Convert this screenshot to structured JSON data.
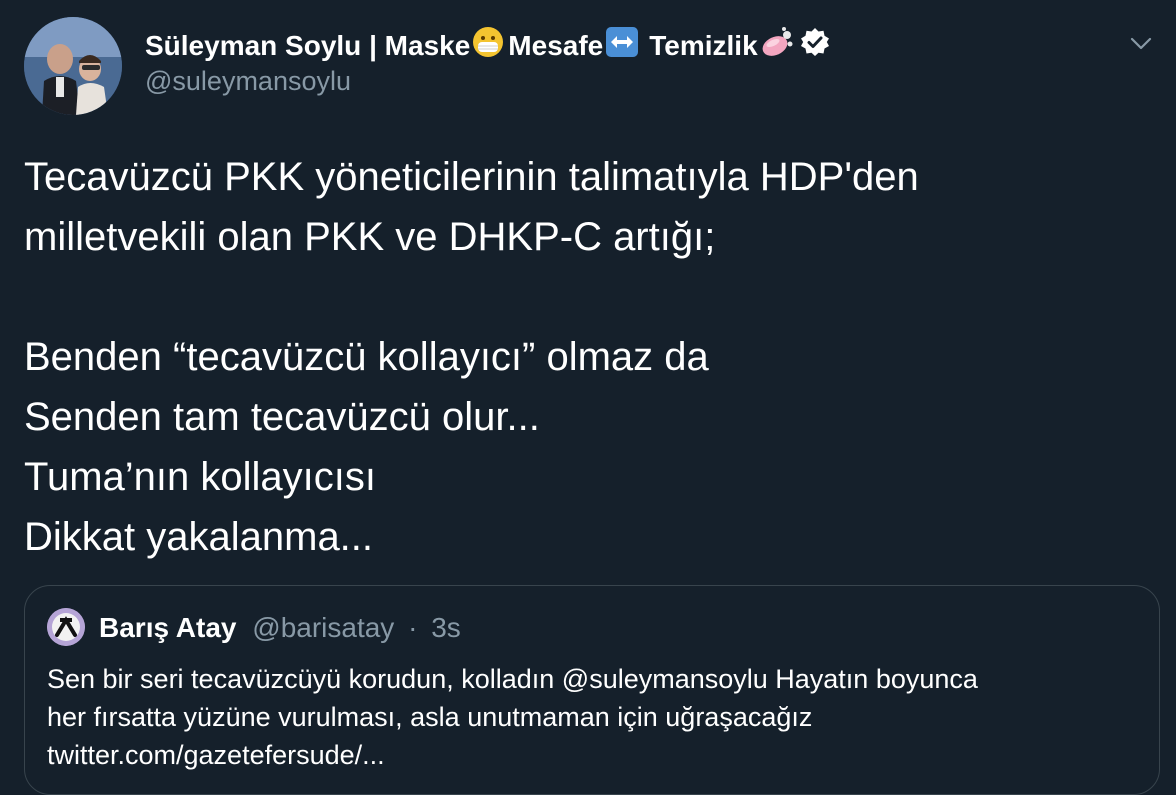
{
  "author": {
    "name": "Süleyman Soylu | Maske",
    "name_part2": "Mesafe",
    "name_part3": "Temizlik",
    "handle": "@suleymansoylu",
    "name_emojis": [
      "mask-emoji",
      "left-right-arrow-emoji",
      "soap-emoji"
    ],
    "verified": true
  },
  "tweet": {
    "lines": [
      "Tecavüzcü PKK yöneticilerinin talimatıyla HDP'den",
      "milletvekili olan PKK ve DHKP-C artığı;",
      "",
      "Benden “tecavüzcü kollayıcı” olmaz da",
      "Senden tam tecavüzcü olur...",
      "Tuma’nın kollayıcısı",
      "Dikkat yakalanma..."
    ]
  },
  "quoted": {
    "name": "Barış Atay",
    "handle": "@barisatay",
    "separator": "·",
    "time": "3s",
    "lines": [
      "Sen bir seri tecavüzcüyü korudun, kolladın @suleymansoylu Hayatın boyunca",
      "her fırsatta yüzüne vurulması, asla unutmaman için uğraşacağız",
      "twitter.com/gazetefersude/..."
    ]
  },
  "colors": {
    "background": "#15202b",
    "text": "#ffffff",
    "secondary_text": "#8899a6",
    "border": "#38444d"
  },
  "icons": [
    "chevron-down-icon",
    "verified-badge-icon"
  ]
}
